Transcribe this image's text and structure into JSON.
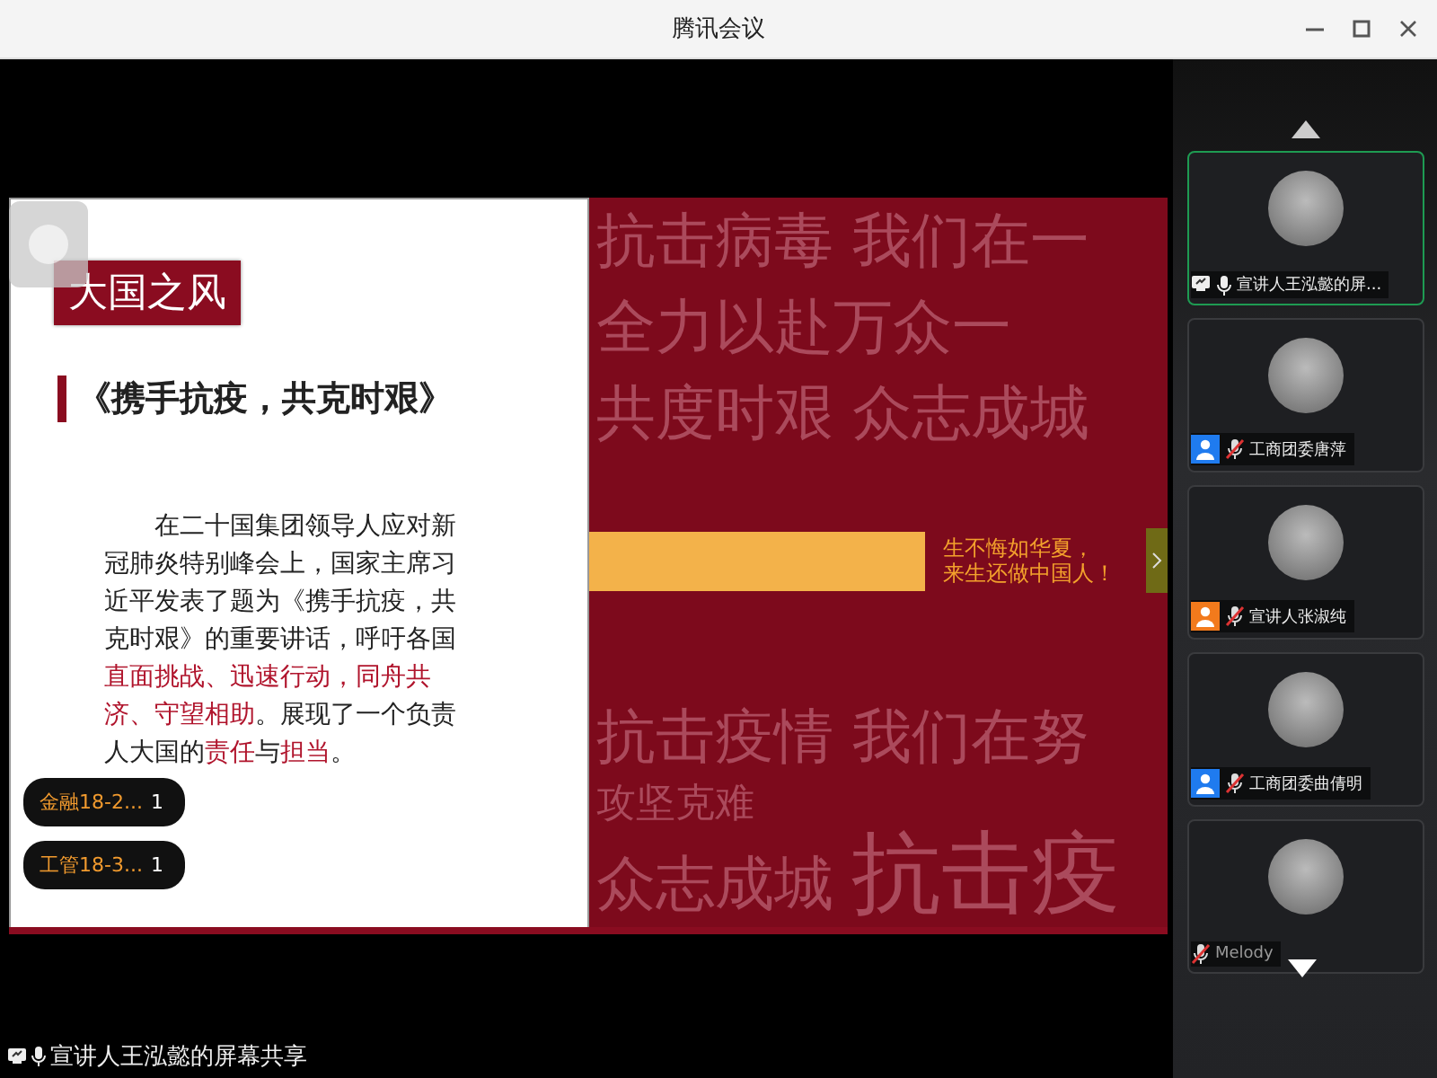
{
  "window": {
    "title": "腾讯会议"
  },
  "slide": {
    "badge": "大国之风",
    "heading": "《携手抗疫，共克时艰》",
    "paragraph": "在二十国集团领导人应对新冠肺炎特别峰会上，国家主席习近平发表了题为《携手抗疫，共克时艰》的重要讲话，呼吁各国**直面挑战、迅速行动，同舟共济、守望相助**。展现了一个负责人大国的**责任**与**担当**。",
    "background_texts": [
      "抗击病毒 我们在一",
      "全力以赴万众一",
      "共度时艰 众志成城"
    ],
    "banner": [
      "生不悔如华夏，",
      "来生还做中国人！"
    ],
    "background_texts_lower": [
      "抗击疫情 我们在努",
      "攻坚克难"
    ],
    "background_texts_bottom": [
      "众志成城",
      "抗击疫"
    ]
  },
  "group_labels": [
    {
      "name": "金融18-2...",
      "count": "1"
    },
    {
      "name": "工管18-3...",
      "count": "1"
    }
  ],
  "participants": [
    {
      "name": "宣讲人王泓懿的屏...",
      "sharing": true,
      "muted": false,
      "selected": true
    },
    {
      "name": "工商团委唐萍",
      "color": "#1f7bef",
      "sharing": false,
      "muted": true,
      "selected": false
    },
    {
      "name": "宣讲人张淑纯",
      "color": "#f27a1c",
      "sharing": false,
      "muted": true,
      "selected": false
    },
    {
      "name": "工商团委曲倩明",
      "color": "#1f7bef",
      "sharing": false,
      "muted": true,
      "selected": false
    },
    {
      "name": "Melody",
      "sharing": false,
      "muted": true,
      "selected": false
    }
  ],
  "status_bar": {
    "text": "宣讲人王泓懿的屏幕共享"
  }
}
